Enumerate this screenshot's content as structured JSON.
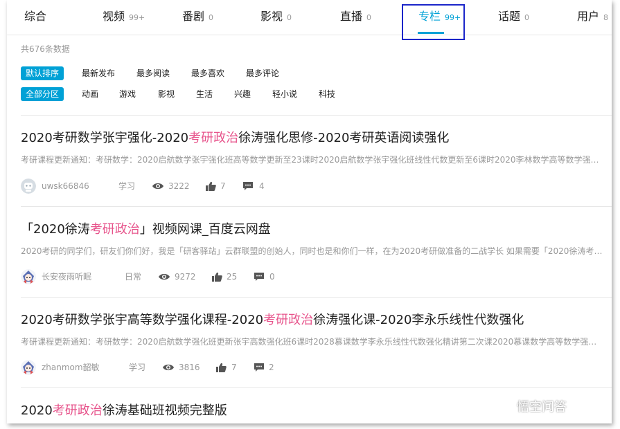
{
  "tabs": [
    {
      "label": "综合",
      "count": ""
    },
    {
      "label": "视频",
      "count": "99+"
    },
    {
      "label": "番剧",
      "count": "0"
    },
    {
      "label": "影视",
      "count": "0"
    },
    {
      "label": "直播",
      "count": "0"
    },
    {
      "label": "专栏",
      "count": "99+"
    },
    {
      "label": "话题",
      "count": "0"
    },
    {
      "label": "用户",
      "count": "8"
    }
  ],
  "active_tab": "专栏",
  "total_text": "共676条数据",
  "sort_options": [
    "默认排序",
    "最新发布",
    "最多阅读",
    "最多喜欢",
    "最多评论"
  ],
  "category_options": [
    "全部分区",
    "动画",
    "游戏",
    "影视",
    "生活",
    "兴趣",
    "轻小说",
    "科技"
  ],
  "colors": {
    "accent": "#00a1d6",
    "keyword": "#e7538b",
    "highlight_box": "#1a25c9"
  },
  "results": [
    {
      "title_pre": "2020考研数学张宇强化-2020",
      "title_kw": "考研政治",
      "title_post": "徐涛强化思修-2020考研英语阅读强化",
      "desc": "考研课程更新通知：考研数学：2020启航数学张宇强化班高等数学更新至23课时2020启航数学张宇强化班线性代数更新至6课时2020李林数学高等数学强化...",
      "author": "uwsk66846",
      "category": "学习",
      "views": "3222",
      "likes": "7",
      "comments": "4",
      "avatar_icon": "default-avatar-icon"
    },
    {
      "title_pre": "「2020徐涛",
      "title_kw": "考研政治",
      "title_post": "」视频网课_百度云网盘",
      "desc": "2020考研的同学们，研友们你们好，我是「研客驿站」云群联盟的创始人，同时也是和你们一样，在为2020考研做准备的二战学长 如果需要「2020徐涛考研...",
      "author": "长安夜雨听眠",
      "category": "日常",
      "views": "9272",
      "likes": "25",
      "comments": "0",
      "avatar_icon": "anime-avatar-icon"
    },
    {
      "title_pre": "2020考研数学张宇高等数学强化课程-2020",
      "title_kw": "考研政治",
      "title_post": "徐涛强化课-2020李永乐线性代数强化",
      "desc": "考研课程更新通知：考研数学：2020启航数学强化班更新张宇高数强化班6课时2028慕课数学李永乐线性代数强化精讲第二次课2020慕课数学高等数学强化班...",
      "author": "zhanmom韶敏",
      "category": "学习",
      "views": "3816",
      "likes": "7",
      "comments": "2",
      "avatar_icon": "anime-avatar-icon"
    },
    {
      "title_pre": "2020",
      "title_kw": "考研政治",
      "title_post": "徐涛基础班视频完整版",
      "desc": "",
      "author": "",
      "category": "",
      "views": "",
      "likes": "",
      "comments": "",
      "avatar_icon": ""
    }
  ],
  "watermark_text": "悟空问答",
  "icons": {
    "views": "eye-icon",
    "likes": "thumbs-up-icon",
    "comments": "comment-icon"
  }
}
